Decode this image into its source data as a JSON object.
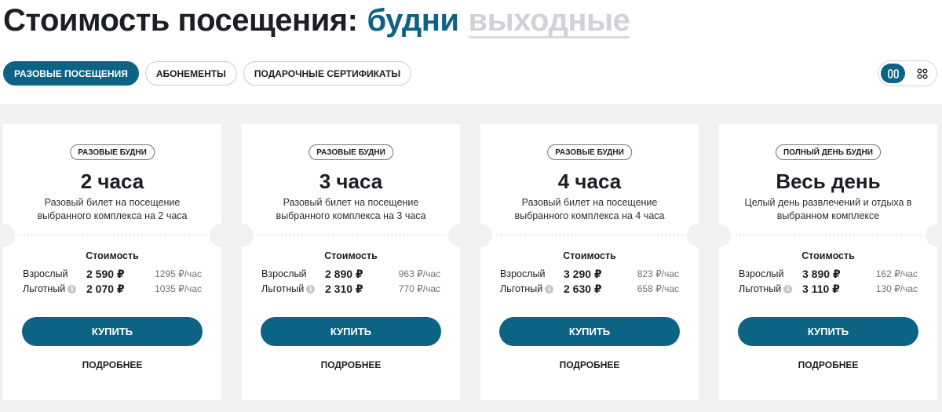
{
  "header": {
    "title": "Стоимость посещения:",
    "day_tabs": [
      "будни",
      "выходные"
    ]
  },
  "pills": [
    "РАЗОВЫЕ ПОСЕЩЕНИЯ",
    "АБОНЕМЕНТЫ",
    "ПОДАРОЧНЫЕ СЕРТИФИКАТЫ"
  ],
  "view_toggle": {
    "active": "columns-icon",
    "other": "grid-icon"
  },
  "colors": {
    "accent": "#0c6383",
    "band": "#f1f2f4",
    "muted_tab": "#cfd3d8"
  },
  "cards": [
    {
      "badge": "РАЗОВЫЕ БУДНИ",
      "title": "2 часа",
      "desc1": "Разовый билет на посещение",
      "desc2": "выбранного комплекса на 2 часа",
      "cost_label": "Стоимость",
      "adult_label": "Взрослый",
      "adult_price": "2 590 ₽",
      "adult_hour": "1295 ₽/час",
      "reduced_label": "Льготный",
      "reduced_price": "2 070 ₽",
      "reduced_hour": "1035 ₽/час",
      "buy": "КУПИТЬ",
      "more": "ПОДРОБНЕЕ"
    },
    {
      "badge": "РАЗОВЫЕ БУДНИ",
      "title": "3 часа",
      "desc1": "Разовый билет на посещение",
      "desc2": "выбранного комплекса на 3 часа",
      "cost_label": "Стоимость",
      "adult_label": "Взрослый",
      "adult_price": "2 890 ₽",
      "adult_hour": "963 ₽/час",
      "reduced_label": "Льготный",
      "reduced_price": "2 310 ₽",
      "reduced_hour": "770 ₽/час",
      "buy": "КУПИТЬ",
      "more": "ПОДРОБНЕЕ"
    },
    {
      "badge": "РАЗОВЫЕ БУДНИ",
      "title": "4 часа",
      "desc1": "Разовый билет на посещение",
      "desc2": "выбранного комплекса на 4 часа",
      "cost_label": "Стоимость",
      "adult_label": "Взрослый",
      "adult_price": "3 290 ₽",
      "adult_hour": "823 ₽/час",
      "reduced_label": "Льготный",
      "reduced_price": "2 630 ₽",
      "reduced_hour": "658 ₽/час",
      "buy": "КУПИТЬ",
      "more": "ПОДРОБНЕЕ"
    },
    {
      "badge": "ПОЛНЫЙ ДЕНЬ БУДНИ",
      "title": "Весь день",
      "desc1": "Целый день развлечений и отдыха в",
      "desc2": "выбранном комплексе",
      "cost_label": "Стоимость",
      "adult_label": "Взрослый",
      "adult_price": "3 890 ₽",
      "adult_hour": "162 ₽/час",
      "reduced_label": "Льготный",
      "reduced_price": "3 110 ₽",
      "reduced_hour": "130 ₽/час",
      "buy": "КУПИТЬ",
      "more": "ПОДРОБНЕЕ"
    }
  ]
}
